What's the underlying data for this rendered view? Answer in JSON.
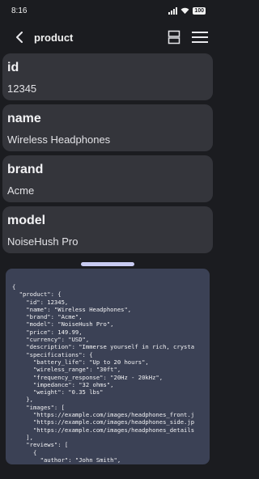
{
  "status": {
    "time": "8:16",
    "battery": "100"
  },
  "header": {
    "title": "product"
  },
  "fields": [
    {
      "label": "id",
      "value": "12345"
    },
    {
      "label": "name",
      "value": "Wireless Headphones"
    },
    {
      "label": "brand",
      "value": "Acme"
    },
    {
      "label": "model",
      "value": "NoiseHush Pro"
    }
  ],
  "json_preview": "{\n  \"product\": {\n    \"id\": 12345,\n    \"name\": \"Wireless Headphones\",\n    \"brand\": \"Acme\",\n    \"model\": \"NoiseHush Pro\",\n    \"price\": 149.99,\n    \"currency\": \"USD\",\n    \"description\": \"Immerse yourself in rich, crysta\n    \"specifications\": {\n      \"battery_life\": \"Up to 20 hours\",\n      \"wireless_range\": \"30ft\",\n      \"frequency_response\": \"20Hz - 20kHz\",\n      \"impedance\": \"32 ohms\",\n      \"weight\": \"0.35 lbs\"\n    },\n    \"images\": [\n      \"https://example.com/images/headphones_front.j\n      \"https://example.com/images/headphones_side.jp\n      \"https://example.com/images/headphones_details\n    ],\n    \"reviews\": [\n      {\n        \"author\": \"John Smith\","
}
